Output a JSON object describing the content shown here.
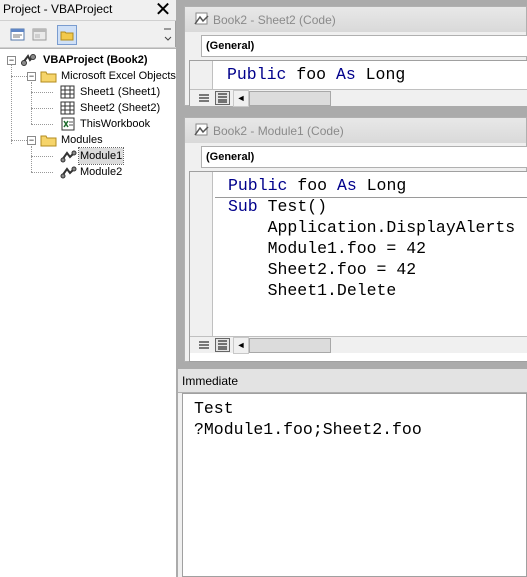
{
  "project": {
    "title": "Project - VBAProject",
    "close_glyph": "✕",
    "toolbar": [
      "view-code-icon",
      "view-object-icon",
      "toggle-folders-icon"
    ],
    "tree": {
      "root": "VBAProject (Book2)",
      "excel_objects_folder": "Microsoft Excel Objects",
      "sheet1": "Sheet1 (Sheet1)",
      "sheet2": "Sheet2 (Sheet2)",
      "thisworkbook": "ThisWorkbook",
      "modules_folder": "Modules",
      "module1": "Module1",
      "module2": "Module2",
      "collapse_glyph": "−"
    }
  },
  "sheet2_window": {
    "title": "Book2 - Sheet2 (Code)",
    "combo": "(General)",
    "code": [
      {
        "kw": "Public",
        "rest": " foo ",
        "kw2": "As",
        "rest2": " Long"
      }
    ]
  },
  "module1_window": {
    "title": "Book2 - Module1 (Code)",
    "combo": "(General)",
    "line1": {
      "kw": "Public",
      "rest": " foo ",
      "kw2": "As",
      "rest2": " Long"
    },
    "line2": {
      "kw": "Sub",
      "rest": " Test()"
    },
    "line3": "    Application.DisplayAlerts",
    "line4": "    Module1.foo = 42",
    "line5": "    Sheet2.foo = 42",
    "line6": "    Sheet1.Delete"
  },
  "immediate": {
    "title": "Immediate",
    "lines": [
      "Test",
      "?Module1.foo;Sheet2.foo"
    ]
  },
  "scroll_left_glyph": "◄"
}
